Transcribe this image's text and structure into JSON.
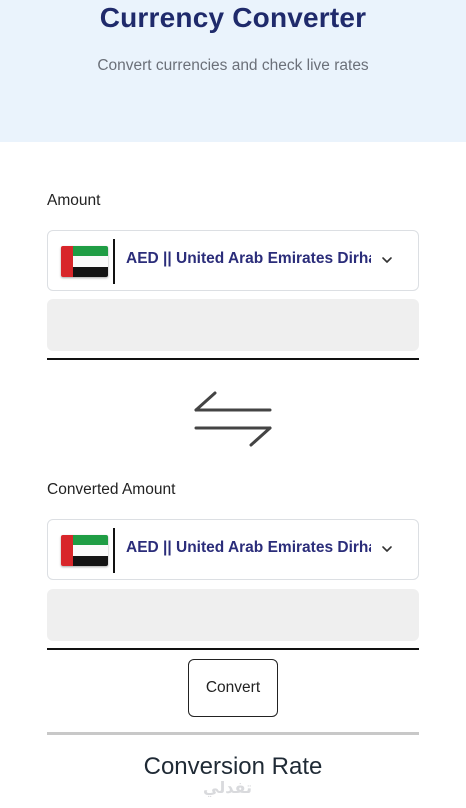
{
  "header": {
    "title": "Currency Converter",
    "subtitle": "Convert currencies and check live rates"
  },
  "amount_section": {
    "label": "Amount",
    "currency_select": {
      "selected": "AED || United Arab Emirates Dirham",
      "flag_icon": "uae-flag-icon"
    },
    "input_value": "",
    "input_placeholder": ""
  },
  "swap": {
    "icon": "swap-arrows-icon"
  },
  "converted_section": {
    "label": "Converted Amount",
    "currency_select": {
      "selected": "AED || United Arab Emirates Dirham",
      "flag_icon": "uae-flag-icon"
    },
    "input_value": "",
    "input_placeholder": ""
  },
  "convert_button": {
    "label": "Convert"
  },
  "conversion_rate": {
    "title": "Conversion Rate"
  },
  "watermark": {
    "text": "تفدلي"
  },
  "colors": {
    "header_bg": "#eaf3fc",
    "title": "#1f2a6b",
    "select_text": "#2b2d7a",
    "input_bg": "#efefef"
  }
}
